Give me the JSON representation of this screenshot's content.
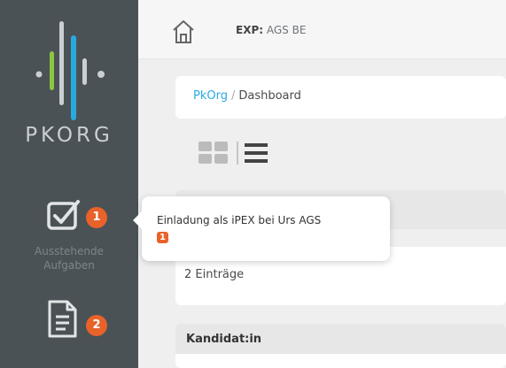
{
  "sidebar": {
    "logo_text": "PKORG",
    "tasks": {
      "label_line1": "Ausstehende",
      "label_line2": "Aufgaben",
      "badge": "1"
    },
    "documents": {
      "badge": "2"
    }
  },
  "topbar": {
    "exp_prefix": "EXP:",
    "exp_value": "AGS BE"
  },
  "breadcrumb": {
    "root": "PkOrg",
    "separator": "/",
    "current": "Dashboard"
  },
  "list": {
    "entries_text": "2 Einträge"
  },
  "table": {
    "columns": [
      "Kandidat:in"
    ]
  },
  "tooltip": {
    "text": "Einladung als iPEX bei Urs AGS",
    "badge": "1"
  },
  "colors": {
    "sidebar": "#4a5256",
    "accent": "#2aa9e0",
    "badge": "#e8622a",
    "logo_green": "#8cc63f"
  }
}
